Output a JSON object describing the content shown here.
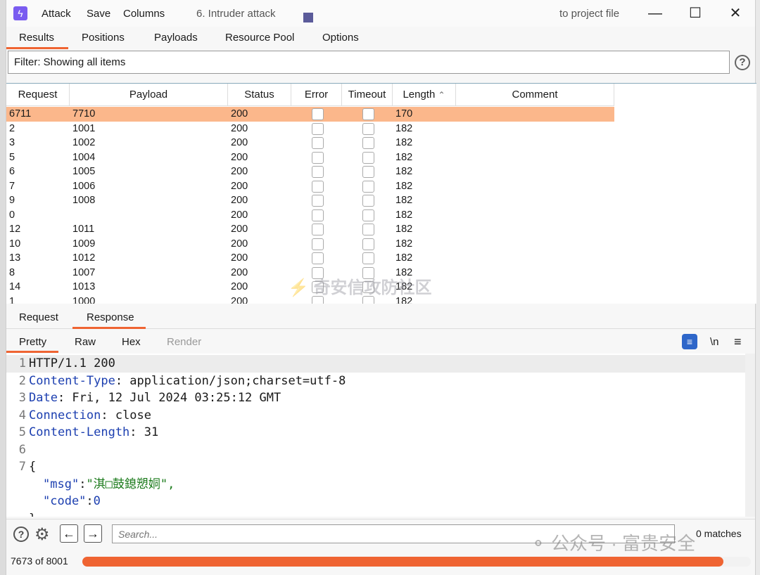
{
  "titlebar": {
    "menu": [
      "Attack",
      "Save",
      "Columns"
    ],
    "window_title": "6. Intruder attack",
    "project_text": "to project file",
    "app_icon": "lightning-icon",
    "controls": [
      "minimize-icon",
      "maximize-icon",
      "close-icon"
    ]
  },
  "main_tabs": [
    "Results",
    "Positions",
    "Payloads",
    "Resource Pool",
    "Options"
  ],
  "active_main_tab": "Results",
  "filter": {
    "text": "Filter: Showing all items"
  },
  "table": {
    "columns": [
      "Request",
      "Payload",
      "Status",
      "Error",
      "Timeout",
      "Length",
      "Comment"
    ],
    "sort_column": "Length",
    "rows": [
      {
        "request": "6711",
        "payload": "7710",
        "status": "200",
        "length": "170"
      },
      {
        "request": "2",
        "payload": "1001",
        "status": "200",
        "length": "182"
      },
      {
        "request": "3",
        "payload": "1002",
        "status": "200",
        "length": "182"
      },
      {
        "request": "5",
        "payload": "1004",
        "status": "200",
        "length": "182"
      },
      {
        "request": "6",
        "payload": "1005",
        "status": "200",
        "length": "182"
      },
      {
        "request": "7",
        "payload": "1006",
        "status": "200",
        "length": "182"
      },
      {
        "request": "9",
        "payload": "1008",
        "status": "200",
        "length": "182"
      },
      {
        "request": "0",
        "payload": "",
        "status": "200",
        "length": "182"
      },
      {
        "request": "12",
        "payload": "1011",
        "status": "200",
        "length": "182"
      },
      {
        "request": "10",
        "payload": "1009",
        "status": "200",
        "length": "182"
      },
      {
        "request": "13",
        "payload": "1012",
        "status": "200",
        "length": "182"
      },
      {
        "request": "8",
        "payload": "1007",
        "status": "200",
        "length": "182"
      },
      {
        "request": "14",
        "payload": "1013",
        "status": "200",
        "length": "182"
      },
      {
        "request": "1",
        "payload": "1000",
        "status": "200",
        "length": "182"
      }
    ],
    "selected_row_color": "#fbb78b"
  },
  "detail_tabs": [
    "Request",
    "Response"
  ],
  "active_detail_tab": "Response",
  "view_tabs": [
    "Pretty",
    "Raw",
    "Hex",
    "Render"
  ],
  "active_view_tab": "Pretty",
  "view_icons": {
    "wrap": "wrap-lines-icon",
    "newline": "\\n",
    "menu": "hamburger-menu-icon"
  },
  "response_lines": [
    {
      "n": "1",
      "key": "",
      "rest": "HTTP/1.1 200"
    },
    {
      "n": "2",
      "key": "Content-Type",
      "rest": ": application/json;charset=utf-8"
    },
    {
      "n": "3",
      "key": "Date",
      "rest": ": Fri, 12 Jul 2024 03:25:12 GMT"
    },
    {
      "n": "4",
      "key": "Connection",
      "rest": ": close"
    },
    {
      "n": "5",
      "key": "Content-Length",
      "rest": ": 31"
    },
    {
      "n": "6",
      "key": "",
      "rest": ""
    },
    {
      "n": "7",
      "key": "",
      "rest": "{"
    },
    {
      "n": "",
      "key": "\"msg\"",
      "rest": ":",
      "str": "\"淇□鼓鎴愬姛\","
    },
    {
      "n": "",
      "key": "\"code\"",
      "rest": ":",
      "num": "0"
    },
    {
      "n": "",
      "key": "",
      "rest": "}"
    }
  ],
  "search": {
    "placeholder": "Search...",
    "matches": "0 matches"
  },
  "status": {
    "progress_text": "7673 of 8001",
    "progress_fraction": 0.959,
    "accent": "#ef6432"
  },
  "watermarks": [
    "奇安信攻防社区",
    "公众号 · 富贵安全"
  ]
}
